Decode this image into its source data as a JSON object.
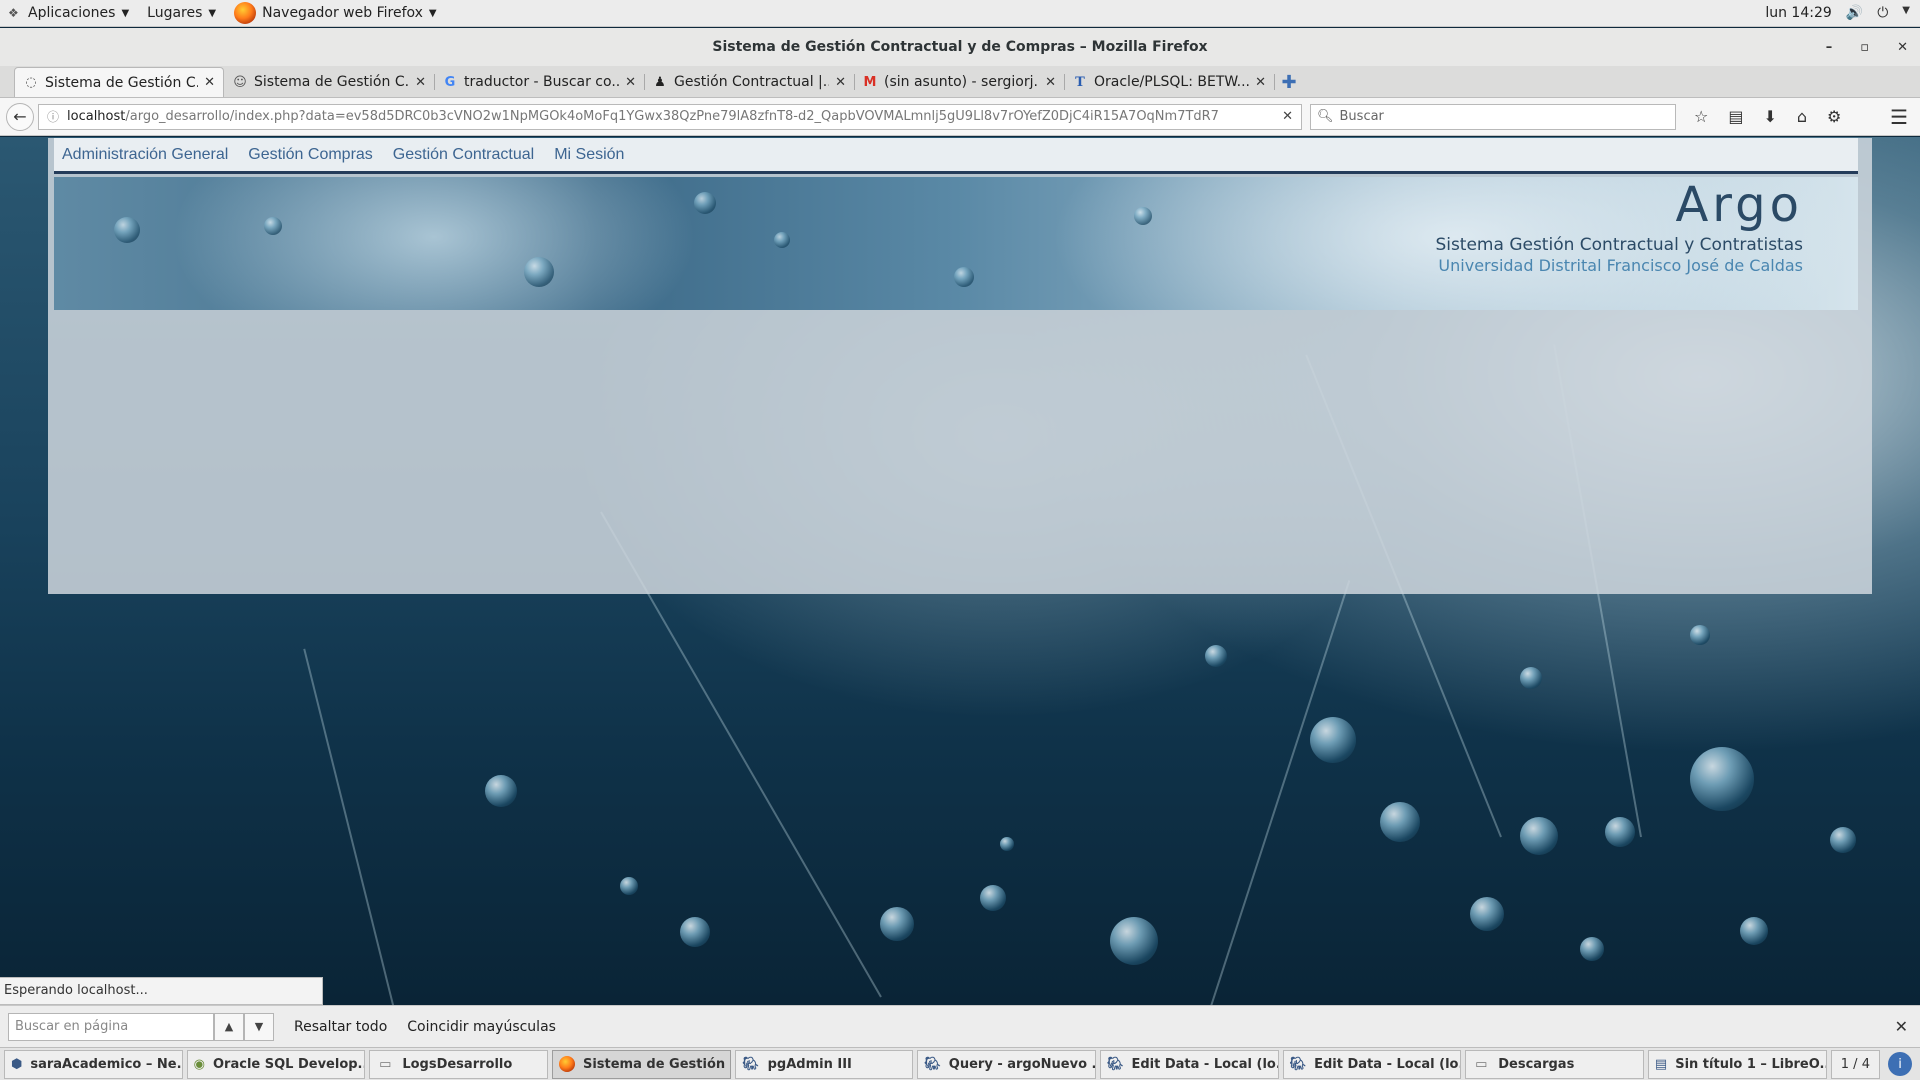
{
  "topbar": {
    "applications": "Aplicaciones",
    "places": "Lugares",
    "active_app": "Navegador web Firefox",
    "clock": "lun 14:29"
  },
  "window": {
    "title": "Sistema de Gestión Contractual y de Compras – Mozilla Firefox"
  },
  "tabs": [
    {
      "label": "Sistema de Gestión C...",
      "icon": "loading-icon",
      "active": true
    },
    {
      "label": "Sistema de Gestión C...",
      "icon": "mask-icon",
      "active": false
    },
    {
      "label": "traductor - Buscar co...",
      "icon": "google-icon",
      "active": false
    },
    {
      "label": "Gestión Contractual |...",
      "icon": "github-icon",
      "active": false
    },
    {
      "label": "(sin asunto) - sergiorj...",
      "icon": "gmail-icon",
      "active": false
    },
    {
      "label": "Oracle/PLSQL: BETW...",
      "icon": "t-icon",
      "active": false
    }
  ],
  "navbar": {
    "url_host": "localhost",
    "url_path": "/argo_desarrollo/index.php?data=ev58d5DRC0b3cVNO2w1NpMGOk4oMoFq1YGwx38QzPne79lA8zfnT8-d2_QapbVOVMALmnlj5gU9Ll8v7rOYefZ0DjC4iR15A7OqNm7TdR7",
    "search_placeholder": "Buscar"
  },
  "site": {
    "menu": [
      "Administración General",
      "Gestión Compras",
      "Gestión Contractual",
      "Mi Sesión"
    ],
    "title": "Argo",
    "subtitle": "Sistema Gestión Contractual y Contratistas",
    "university": "Universidad Distrital Francisco José de Caldas"
  },
  "status_text": "Esperando localhost...",
  "findbar": {
    "placeholder": "Buscar en página",
    "highlight_all": "Resaltar todo",
    "match_case": "Coincidir mayúsculas"
  },
  "taskbar": {
    "tasks": [
      {
        "label": "saraAcademico – Ne...",
        "icon": "netbeans-icon",
        "active": false
      },
      {
        "label": "Oracle SQL Develop...",
        "icon": "sqldeveloper-icon",
        "active": false
      },
      {
        "label": "LogsDesarrollo",
        "icon": "folder-icon",
        "active": false
      },
      {
        "label": "Sistema de Gestión ...",
        "icon": "firefox-icon",
        "active": true
      },
      {
        "label": "pgAdmin III",
        "icon": "elephant-icon",
        "active": false
      },
      {
        "label": "Query - argoNuevo ...",
        "icon": "elephant-icon",
        "active": false
      },
      {
        "label": "Edit Data - Local (lo...",
        "icon": "elephant-icon",
        "active": false
      },
      {
        "label": "Edit Data - Local (lo...",
        "icon": "elephant-icon",
        "active": false
      },
      {
        "label": "Descargas",
        "icon": "folder-icon",
        "active": false
      },
      {
        "label": "Sin título 1 – LibreO...",
        "icon": "document-icon",
        "active": false
      }
    ],
    "workspace": "1 / 4"
  }
}
